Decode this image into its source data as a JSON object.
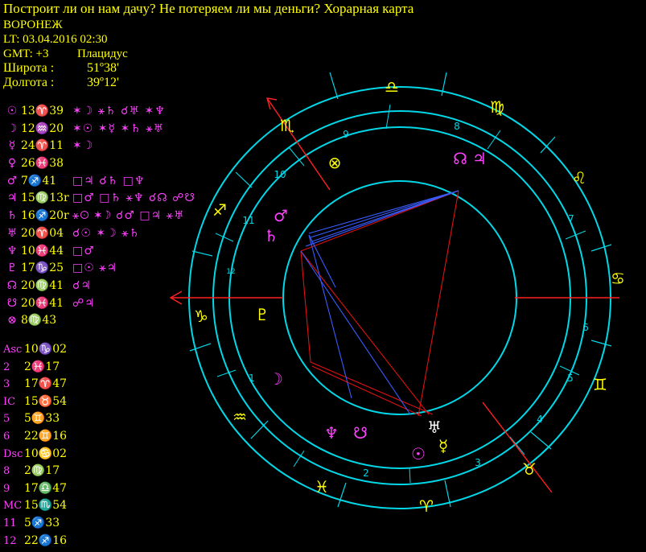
{
  "header": {
    "title": "Построит ли он нам дачу? Не потеряем ли мы деньги? Хорарная карта",
    "city": "ВОРОНЕЖ",
    "lt": "LT: 03.04.2016  02:30",
    "gmt": "GMT: +3",
    "system": "Плацидус",
    "lat_label": "Широта :",
    "lat_value": "51º38'",
    "lon_label": "Долгота :",
    "lon_value": "39º12'"
  },
  "planets": [
    {
      "glyph": "☉",
      "pos": "13♈39",
      "aspects": "✶☽ ⚹♄ ☌♅ ✶♆"
    },
    {
      "glyph": "☽",
      "pos": "12♒20",
      "aspects": "✶☉ ✶☿ ✶♄ ⚹♅"
    },
    {
      "glyph": "☿",
      "pos": "24♈11",
      "aspects": "✶☽"
    },
    {
      "glyph": "♀",
      "pos": "26♓38",
      "aspects": ""
    },
    {
      "glyph": "♂",
      "pos": "7♐41",
      "aspects": "□♃ ☌♄ □♆"
    },
    {
      "glyph": "♃",
      "pos": "15♍13r",
      "aspects": "□♂ □♄ ⚹♆ ☌☊ ☍☋"
    },
    {
      "glyph": "♄",
      "pos": "16♐20r",
      "aspects": "⚹☉ ✶☽ ☌♂ □♃ ⚹♅"
    },
    {
      "glyph": "♅",
      "pos": "20♈04",
      "aspects": "☌☉ ✶☽ ⚹♄"
    },
    {
      "glyph": "♆",
      "pos": "10♓44",
      "aspects": "□♂"
    },
    {
      "glyph": "♇",
      "pos": "17♑25",
      "aspects": "□☉ ⚹♃"
    },
    {
      "glyph": "☊",
      "pos": "20♍41",
      "aspects": "☌♃"
    },
    {
      "glyph": "☋",
      "pos": "20♓41",
      "aspects": "☍♃"
    },
    {
      "glyph": "⊗",
      "pos": "8♍43",
      "aspects": ""
    }
  ],
  "cusps": [
    {
      "label": "Asc",
      "pos": "10♑02"
    },
    {
      "label": "2",
      "pos": "2♓17"
    },
    {
      "label": "3",
      "pos": "17♈47"
    },
    {
      "label": "IC",
      "pos": "15♉54"
    },
    {
      "label": "5",
      "pos": "5♊33"
    },
    {
      "label": "6",
      "pos": "22♊16"
    },
    {
      "label": "Dsc",
      "pos": "10♋02"
    },
    {
      "label": "8",
      "pos": "2♍17"
    },
    {
      "label": "9",
      "pos": "17♎47"
    },
    {
      "label": "MC",
      "pos": "15♏54"
    },
    {
      "label": "11",
      "pos": "5♐33"
    },
    {
      "label": "12",
      "pos": "22♐16"
    }
  ],
  "wheel": {
    "signs": [
      "♎",
      "♍",
      "♌",
      "♋",
      "♊",
      "♉",
      "♈",
      "♓",
      "♒",
      "♑",
      "♐",
      "♏"
    ],
    "house_numbers": [
      "1",
      "2",
      "3",
      "4",
      "5",
      "6",
      "7",
      "8",
      "9",
      "10",
      "11",
      "12"
    ],
    "inner_planets": [
      "☉",
      "☽",
      "☿",
      "♂",
      "♃",
      "♄",
      "♅",
      "♆",
      "♇",
      "☊",
      "☋",
      "⊗"
    ],
    "colors": {
      "ring": "#00d8e8",
      "header": "#ffff00",
      "planet": "#ff40ff",
      "sign": "#ffff00",
      "axis": "#ff2020",
      "aspect_red": "#e01010",
      "aspect_blue": "#3a5cff"
    }
  }
}
